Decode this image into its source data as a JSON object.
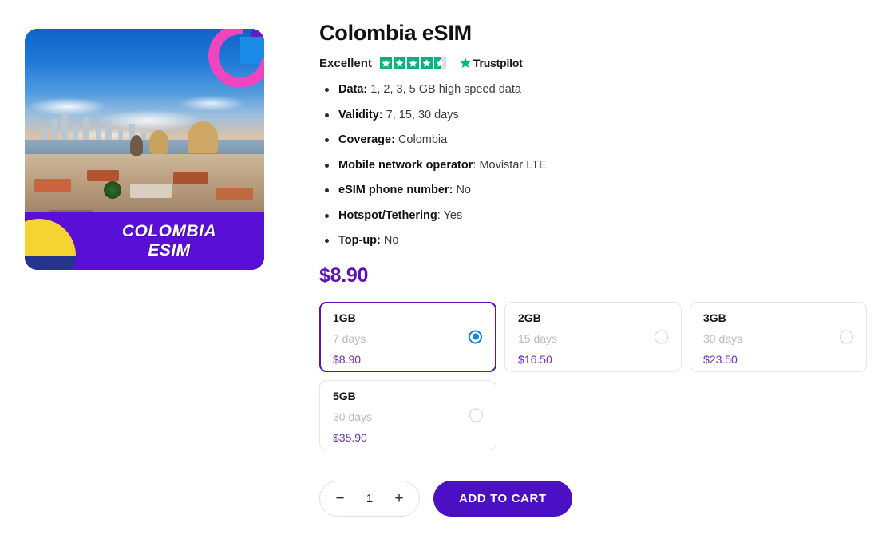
{
  "product": {
    "title": "Colombia eSIM",
    "price": "$8.90",
    "image": {
      "banner_line1": "COLOMBIA",
      "banner_line2": "ESIM",
      "flag_colors": [
        "#F5D431",
        "#27348B",
        "#CE1126"
      ],
      "banner_color": "#5A0FD6",
      "alt": "Cartagena Colombia skyline"
    }
  },
  "rating": {
    "label": "Excellent",
    "stars_filled": 4.5,
    "stars_total": 5,
    "star_color": "#00B67A",
    "brand": "Trustpilot"
  },
  "features": [
    {
      "key": "Data:",
      "value": "1, 2, 3, 5 GB high speed data"
    },
    {
      "key": "Validity:",
      "value": "7, 15, 30 days"
    },
    {
      "key": "Coverage:",
      "value": "Colombia"
    },
    {
      "key": "Mobile network operator",
      "value": ": Movistar LTE"
    },
    {
      "key": "eSIM phone number:",
      "value": "No"
    },
    {
      "key": "Hotspot/Tethering",
      "value": ": Yes"
    },
    {
      "key": "Top-up:",
      "value": "No"
    }
  ],
  "plans": [
    {
      "size": "1GB",
      "days": "7 days",
      "price": "$8.90",
      "selected": true
    },
    {
      "size": "2GB",
      "days": "15 days",
      "price": "$16.50",
      "selected": false
    },
    {
      "size": "3GB",
      "days": "30 days",
      "price": "$23.50",
      "selected": false
    },
    {
      "size": "5GB",
      "days": "30 days",
      "price": "$35.90",
      "selected": false
    }
  ],
  "cart": {
    "decrement": "−",
    "quantity": "1",
    "increment": "+",
    "add_label": "ADD TO CART",
    "add_color": "#4B0FC4"
  },
  "colors": {
    "accent_purple": "#5B13B8",
    "plan_price": "#6C2FC4",
    "radio_blue": "#1184E0"
  }
}
